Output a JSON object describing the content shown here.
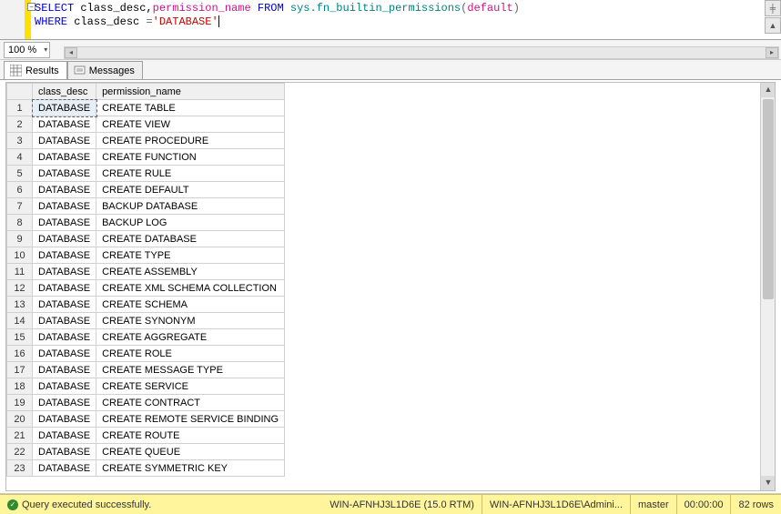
{
  "editor": {
    "sql_parts": {
      "select": "SELECT",
      "cols": " class_desc,",
      "col2": "permission_name",
      "from": " FROM ",
      "func": "sys.fn_builtin_permissions",
      "lp": "(",
      "defkw": "default",
      "rp": ")",
      "where": "WHERE",
      "where_col": " class_desc ",
      "eq": "=",
      "str": "'DATABASE'"
    },
    "zoom": "100 %"
  },
  "tabs": {
    "results": "Results",
    "messages": "Messages"
  },
  "grid": {
    "columns": {
      "rownum": "",
      "class_desc": "class_desc",
      "permission_name": "permission_name"
    },
    "rows": [
      {
        "n": "1",
        "class_desc": "DATABASE",
        "permission_name": "CREATE TABLE"
      },
      {
        "n": "2",
        "class_desc": "DATABASE",
        "permission_name": "CREATE VIEW"
      },
      {
        "n": "3",
        "class_desc": "DATABASE",
        "permission_name": "CREATE PROCEDURE"
      },
      {
        "n": "4",
        "class_desc": "DATABASE",
        "permission_name": "CREATE FUNCTION"
      },
      {
        "n": "5",
        "class_desc": "DATABASE",
        "permission_name": "CREATE RULE"
      },
      {
        "n": "6",
        "class_desc": "DATABASE",
        "permission_name": "CREATE DEFAULT"
      },
      {
        "n": "7",
        "class_desc": "DATABASE",
        "permission_name": "BACKUP DATABASE"
      },
      {
        "n": "8",
        "class_desc": "DATABASE",
        "permission_name": "BACKUP LOG"
      },
      {
        "n": "9",
        "class_desc": "DATABASE",
        "permission_name": "CREATE DATABASE"
      },
      {
        "n": "10",
        "class_desc": "DATABASE",
        "permission_name": "CREATE TYPE"
      },
      {
        "n": "11",
        "class_desc": "DATABASE",
        "permission_name": "CREATE ASSEMBLY"
      },
      {
        "n": "12",
        "class_desc": "DATABASE",
        "permission_name": "CREATE XML SCHEMA COLLECTION"
      },
      {
        "n": "13",
        "class_desc": "DATABASE",
        "permission_name": "CREATE SCHEMA"
      },
      {
        "n": "14",
        "class_desc": "DATABASE",
        "permission_name": "CREATE SYNONYM"
      },
      {
        "n": "15",
        "class_desc": "DATABASE",
        "permission_name": "CREATE AGGREGATE"
      },
      {
        "n": "16",
        "class_desc": "DATABASE",
        "permission_name": "CREATE ROLE"
      },
      {
        "n": "17",
        "class_desc": "DATABASE",
        "permission_name": "CREATE MESSAGE TYPE"
      },
      {
        "n": "18",
        "class_desc": "DATABASE",
        "permission_name": "CREATE SERVICE"
      },
      {
        "n": "19",
        "class_desc": "DATABASE",
        "permission_name": "CREATE CONTRACT"
      },
      {
        "n": "20",
        "class_desc": "DATABASE",
        "permission_name": "CREATE REMOTE SERVICE BINDING"
      },
      {
        "n": "21",
        "class_desc": "DATABASE",
        "permission_name": "CREATE ROUTE"
      },
      {
        "n": "22",
        "class_desc": "DATABASE",
        "permission_name": "CREATE QUEUE"
      },
      {
        "n": "23",
        "class_desc": "DATABASE",
        "permission_name": "CREATE SYMMETRIC KEY"
      }
    ]
  },
  "status": {
    "message": "Query executed successfully.",
    "server": "WIN-AFNHJ3L1D6E (15.0 RTM)",
    "user": "WIN-AFNHJ3L1D6E\\Admini...",
    "db": "master",
    "elapsed": "00:00:00",
    "rows": "82 rows"
  }
}
